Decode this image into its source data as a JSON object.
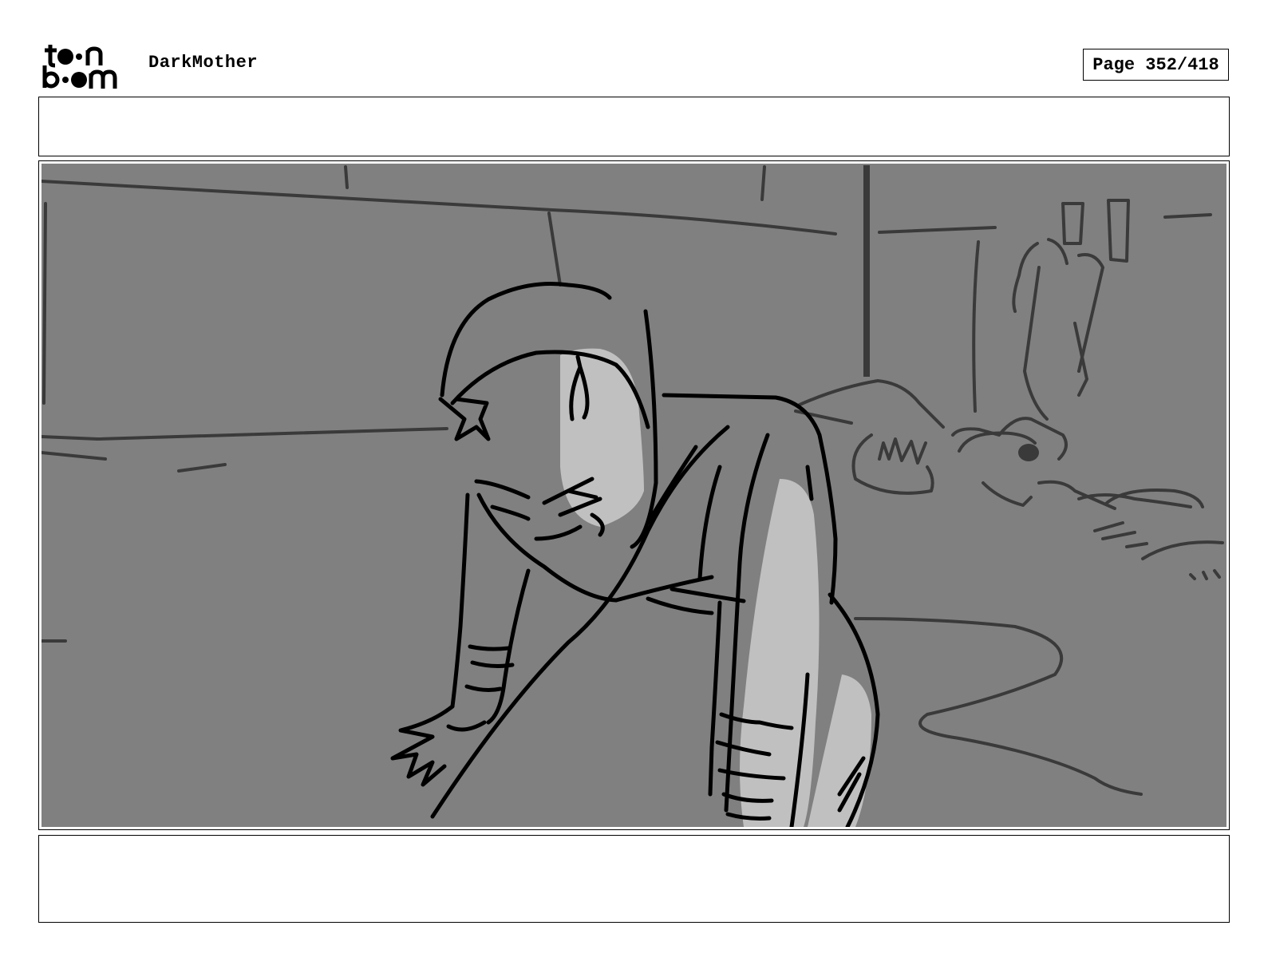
{
  "header": {
    "logo_text": "toon boom",
    "project_title": "DarkMother",
    "page_label": "Page 352/418"
  },
  "panel": {
    "background_color": "#808080",
    "highlight_color": "#c0c0c0",
    "line_color": "#000000"
  }
}
